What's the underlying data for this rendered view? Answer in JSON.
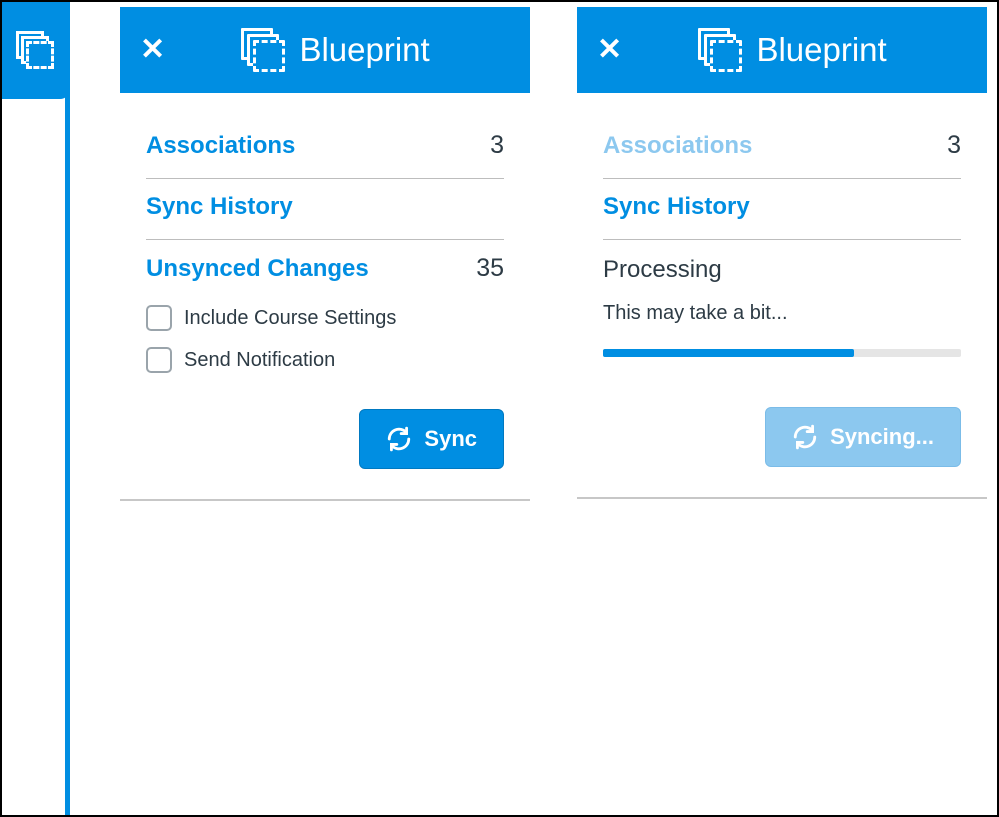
{
  "colors": {
    "accent": "#008ee2"
  },
  "dock": {
    "icon": "blueprint-icon"
  },
  "panel_a": {
    "title": "Blueprint",
    "associations": {
      "label": "Associations",
      "count": 3
    },
    "sync_history_label": "Sync History",
    "unsynced": {
      "label": "Unsynced Changes",
      "count": 35
    },
    "options": {
      "include_settings": "Include Course Settings",
      "send_notification": "Send Notification"
    },
    "sync_button": "Sync"
  },
  "panel_b": {
    "title": "Blueprint",
    "associations": {
      "label": "Associations",
      "count": 3
    },
    "sync_history_label": "Sync History",
    "processing": {
      "heading": "Processing",
      "subtext": "This may take a bit...",
      "progress_pct": 70
    },
    "syncing_button": "Syncing..."
  }
}
